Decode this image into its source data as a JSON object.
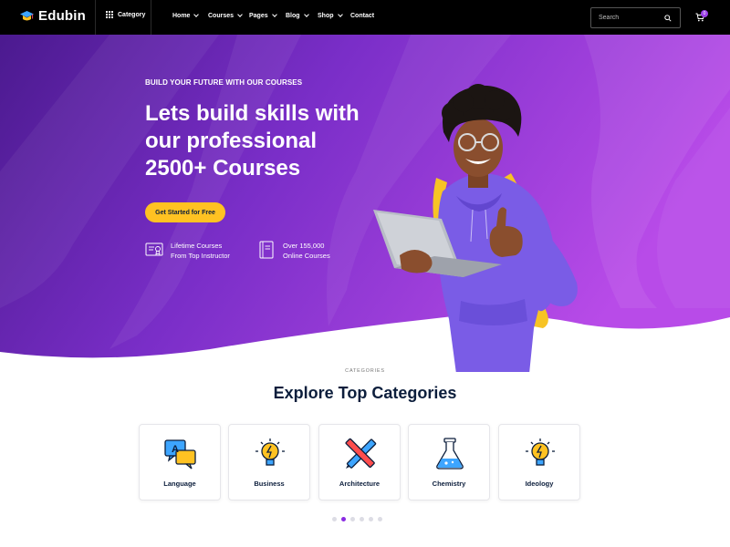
{
  "brand": {
    "name": "Edubin",
    "accent": "#8a2be2",
    "cta_color": "#ffc222"
  },
  "header": {
    "category_label": "Category",
    "nav": [
      {
        "label": "Home",
        "has_dropdown": true
      },
      {
        "label": "Courses",
        "has_dropdown": true
      },
      {
        "label": "Pages",
        "has_dropdown": true
      },
      {
        "label": "Blog",
        "has_dropdown": true
      },
      {
        "label": "Shop",
        "has_dropdown": true
      },
      {
        "label": "Contact",
        "has_dropdown": false
      }
    ],
    "search_placeholder": "Search",
    "cart_count": "0"
  },
  "hero": {
    "tagline": "BUILD YOUR FUTURE WITH OUR COURSES",
    "title_lines": [
      "Lets build skills with",
      "our professional",
      "2500+ Courses"
    ],
    "cta_label": "Get Started for Free",
    "features": [
      {
        "icon": "certificate-icon",
        "line1": "Lifetime Courses",
        "line2": "From Top Instructor"
      },
      {
        "icon": "book-icon",
        "line1": "Over 155,000",
        "line2": "Online Courses"
      }
    ]
  },
  "categories": {
    "eyebrow": "CATEGORIES",
    "title": "Explore Top Categories",
    "items": [
      {
        "label": "Language",
        "icon": "language-icon"
      },
      {
        "label": "Business",
        "icon": "lightbulb-icon"
      },
      {
        "label": "Architecture",
        "icon": "ruler-pencil-icon"
      },
      {
        "label": "Chemistry",
        "icon": "flask-icon"
      },
      {
        "label": "Ideology",
        "icon": "lightbulb-icon"
      }
    ],
    "pagination": {
      "total": 6,
      "active_index": 1
    }
  }
}
